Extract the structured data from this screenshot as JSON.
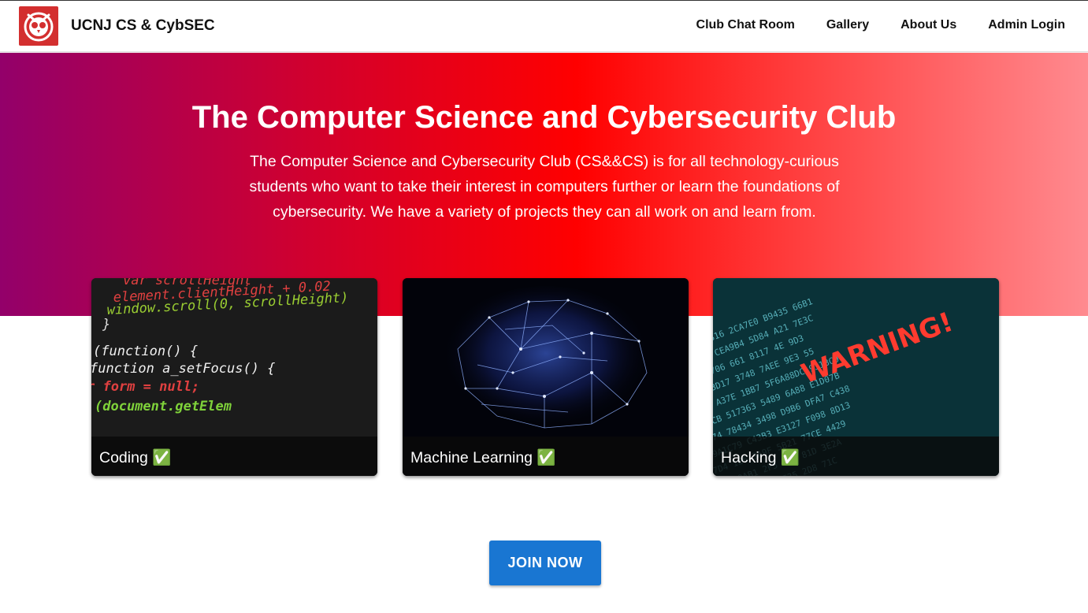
{
  "brand": {
    "name": "UCNJ CS & CybSEC",
    "logo_icon": "owl-logo-icon",
    "logo_color": "#d32f2f"
  },
  "nav": {
    "links": [
      "Club Chat Room",
      "Gallery",
      "About Us",
      "Admin Login"
    ]
  },
  "hero": {
    "title": "The Computer Science and Cybersecurity Club",
    "text": "The Computer Science and Cybersecurity Club (CS&&CS) is for all technology-curious students who want to take their interest in computers further or learn the foundations of cybersecurity. We have a variety of projects they can all work on and learn from.",
    "gradient": [
      "#93006a",
      "#ff0000",
      "#ff8a8f"
    ]
  },
  "cards": [
    {
      "caption": "Coding ✅",
      "code_lines": [
        "var scrollHeight",
        "element.clientHeight + 0.02",
        "window.scroll(0, scrollHeight)",
        "}",
        "(function() {",
        "function a_setFocus() {",
        "r form = null;",
        "(document.getElem"
      ]
    },
    {
      "caption": "Machine Learning ✅"
    },
    {
      "caption": "Hacking ✅",
      "warning_text": "WARNING!"
    }
  ],
  "cta": {
    "label": "JOIN NOW",
    "color": "#1976d2"
  }
}
